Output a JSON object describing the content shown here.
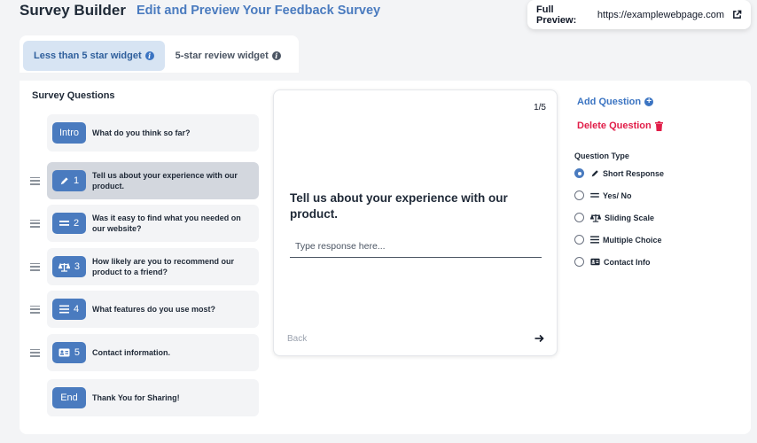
{
  "header": {
    "title": "Survey Builder",
    "subtitle": "Edit and Preview Your Feedback Survey"
  },
  "preview": {
    "label": "Full Preview:",
    "url": "https://examplewebpage.com",
    "icon": "external-link-icon"
  },
  "tabs": [
    {
      "label": "Less than 5 star widget",
      "active": true,
      "icon": "info-icon"
    },
    {
      "label": "5-star review widget",
      "active": false,
      "icon": "info-icon"
    }
  ],
  "survey_questions": {
    "title": "Survey Questions",
    "items": [
      {
        "badge": "Intro",
        "icon": "",
        "text": "What do you think so far?",
        "draggable": false,
        "selected": false
      },
      {
        "badge": "1",
        "icon": "pencil-icon",
        "text": "Tell us about your experience with our product.",
        "draggable": true,
        "selected": true
      },
      {
        "badge": "2",
        "icon": "yes-no-icon",
        "text": "Was it easy to find what you needed on our website?",
        "draggable": true,
        "selected": false
      },
      {
        "badge": "3",
        "icon": "scale-icon",
        "text": "How likely are you to recommend our product to a friend?",
        "draggable": true,
        "selected": false
      },
      {
        "badge": "4",
        "icon": "list-icon",
        "text": "What features do you use most?",
        "draggable": true,
        "selected": false
      },
      {
        "badge": "5",
        "icon": "contact-card-icon",
        "text": "Contact information.",
        "draggable": true,
        "selected": false
      },
      {
        "badge": "End",
        "icon": "",
        "text": "Thank You for Sharing!",
        "draggable": false,
        "selected": false
      }
    ]
  },
  "preview_card": {
    "counter": "1/5",
    "question": "Tell us about your experience with our product.",
    "placeholder": "Type response here...",
    "back_label": "Back",
    "next_icon": "arrow-right-icon"
  },
  "actions": {
    "add_label": "Add Question",
    "delete_label": "Delete Question"
  },
  "question_type": {
    "label": "Question Type",
    "options": [
      {
        "label": "Short Response",
        "icon": "pencil-icon",
        "selected": true
      },
      {
        "label": "Yes/ No",
        "icon": "yes-no-icon",
        "selected": false
      },
      {
        "label": "Sliding Scale",
        "icon": "scale-icon",
        "selected": false
      },
      {
        "label": "Multiple Choice",
        "icon": "list-icon",
        "selected": false
      },
      {
        "label": "Contact Info",
        "icon": "contact-card-icon",
        "selected": false
      }
    ]
  },
  "colors": {
    "accent": "#4a7bbf",
    "danger": "#e11d48",
    "selected_card": "#d3d7de"
  }
}
